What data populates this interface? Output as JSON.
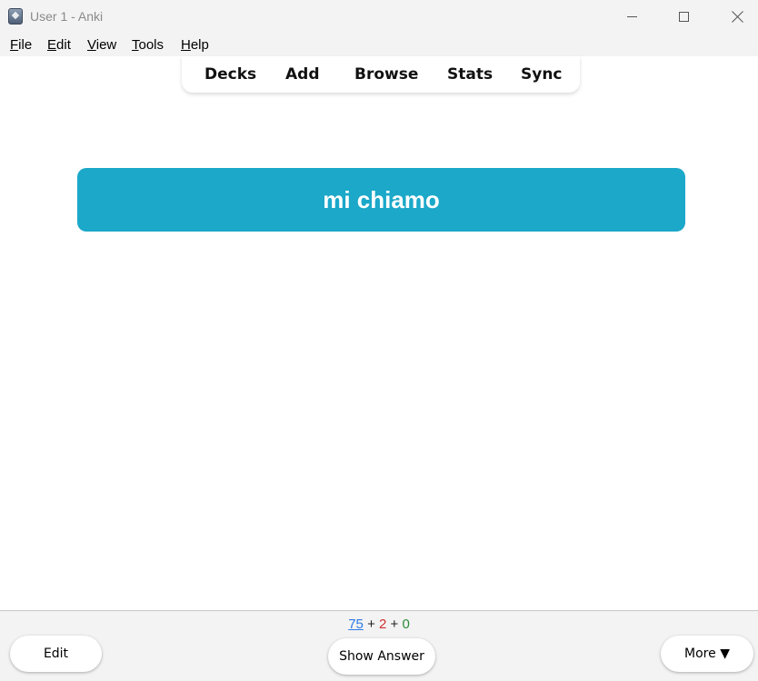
{
  "window": {
    "title": "User 1 - Anki",
    "icon": "anki-app-icon"
  },
  "menu": {
    "items": [
      {
        "label": "File",
        "mnemonic": "F",
        "rest": "ile"
      },
      {
        "label": "Edit",
        "mnemonic": "E",
        "rest": "dit"
      },
      {
        "label": "View",
        "mnemonic": "V",
        "rest": "iew"
      },
      {
        "label": "Tools",
        "mnemonic": "T",
        "rest": "ools"
      },
      {
        "label": "Help",
        "mnemonic": "H",
        "rest": "elp"
      }
    ]
  },
  "toolbar": {
    "decks": "Decks",
    "add": "Add",
    "browse": "Browse",
    "stats": "Stats",
    "sync": "Sync"
  },
  "card": {
    "front": "mi chiamo",
    "background_color": "#1ba8c9"
  },
  "counts": {
    "new": "75",
    "learn": "2",
    "review": "0",
    "separator": "+",
    "new_color": "#2c7be5",
    "learn_color": "#d32f2f",
    "review_color": "#2e8b3a"
  },
  "bottom": {
    "edit_label": "Edit",
    "show_answer_label": "Show Answer",
    "more_label": "More ▼"
  }
}
